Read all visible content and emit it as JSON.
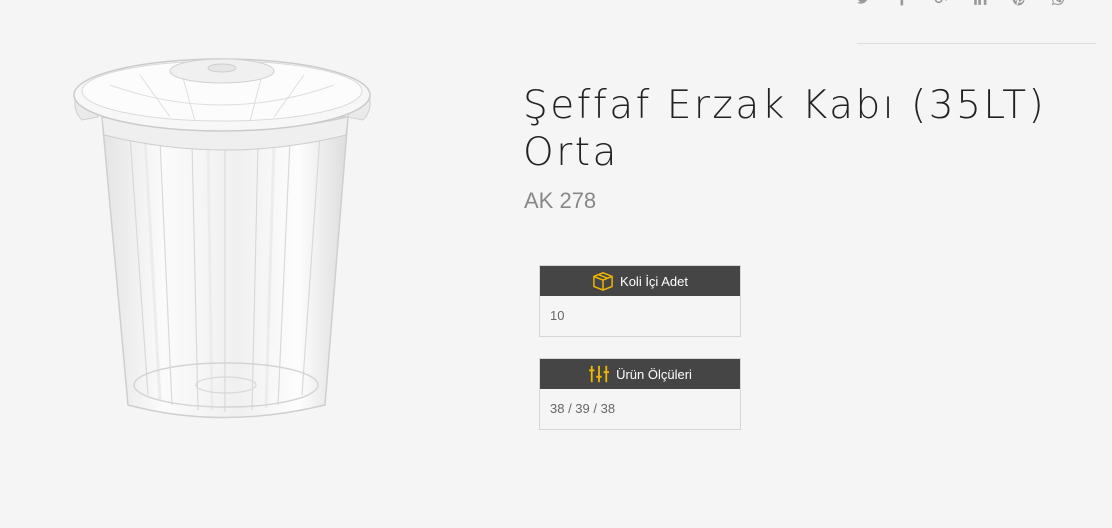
{
  "social": {
    "icons": [
      "twitter-icon",
      "facebook-icon",
      "google-plus-icon",
      "linkedin-icon",
      "pinterest-icon",
      "whatsapp-icon"
    ]
  },
  "product": {
    "title": "Şeffaf Erzak Kabı (35LT) Orta",
    "code": "AK 278",
    "image_alt": "transparent-storage-container"
  },
  "specs": [
    {
      "label": "Koli İçi Adet",
      "value": "10",
      "icon": "box-icon"
    },
    {
      "label": "Ürün Ölçüleri",
      "value": "38 / 39 / 38",
      "icon": "measure-icon"
    }
  ],
  "colors": {
    "header_bg": "#454545",
    "icon_accent": "#f2b800",
    "page_bg": "#f5f5f5"
  }
}
